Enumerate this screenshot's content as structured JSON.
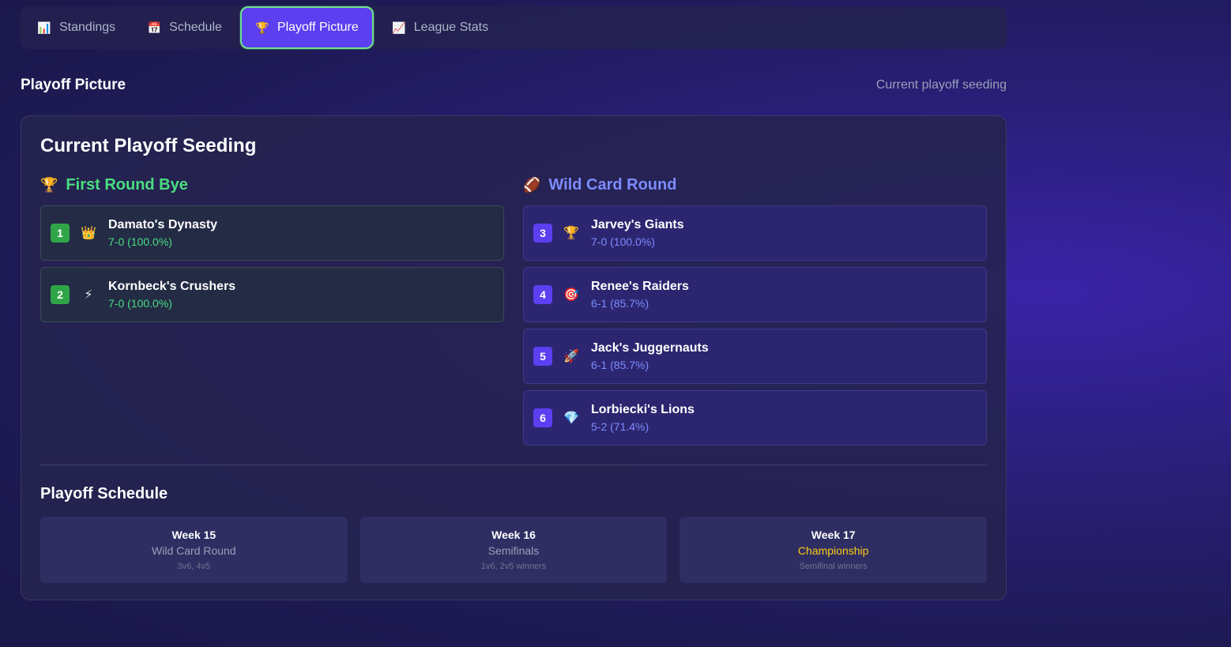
{
  "tabs": [
    {
      "label": "Standings",
      "icon": "bar-chart-icon",
      "glyph": "📊"
    },
    {
      "label": "Schedule",
      "icon": "calendar-icon",
      "glyph": "📅"
    },
    {
      "label": "Playoff Picture",
      "icon": "trophy-icon",
      "glyph": "🏆",
      "active": true
    },
    {
      "label": "League Stats",
      "icon": "line-chart-icon",
      "glyph": "📈"
    }
  ],
  "page": {
    "title": "Playoff Picture",
    "subtitle": "Current playoff seeding"
  },
  "panel": {
    "title": "Current Playoff Seeding",
    "bye": {
      "heading": "First Round Bye",
      "glyph": "🏆",
      "teams": [
        {
          "seed": "1",
          "glyph": "👑",
          "name": "Damato's Dynasty",
          "record": "7-0 (100.0%)"
        },
        {
          "seed": "2",
          "glyph": "⚡",
          "name": "Kornbeck's Crushers",
          "record": "7-0 (100.0%)"
        }
      ]
    },
    "wildcard": {
      "heading": "Wild Card Round",
      "glyph": "🏈",
      "teams": [
        {
          "seed": "3",
          "glyph": "🏆",
          "name": "Jarvey's Giants",
          "record": "7-0 (100.0%)"
        },
        {
          "seed": "4",
          "glyph": "🎯",
          "name": "Renee's Raiders",
          "record": "6-1 (85.7%)"
        },
        {
          "seed": "5",
          "glyph": "🚀",
          "name": "Jack's Juggernauts",
          "record": "6-1 (85.7%)"
        },
        {
          "seed": "6",
          "glyph": "💎",
          "name": "Lorbiecki's Lions",
          "record": "5-2 (71.4%)"
        }
      ]
    }
  },
  "schedule": {
    "title": "Playoff Schedule",
    "weeks": [
      {
        "week": "Week 15",
        "round": "Wild Card Round",
        "matchups": "3v6, 4v5"
      },
      {
        "week": "Week 16",
        "round": "Semifinals",
        "matchups": "1v6, 2v5 winners"
      },
      {
        "week": "Week 17",
        "round": "Championship",
        "matchups": "Semifinal winners"
      }
    ]
  },
  "colors": {
    "accent": "#5b3ff0",
    "green": "#4ade80",
    "blue": "#7c8cff",
    "gold": "#facc15"
  }
}
